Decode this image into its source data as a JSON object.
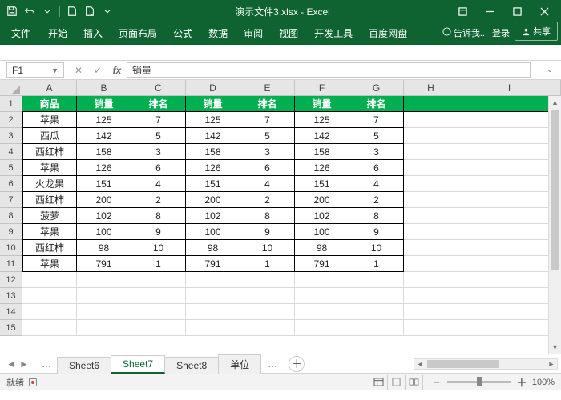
{
  "titlebar": {
    "title": "演示文件3.xlsx - Excel"
  },
  "ribbon": {
    "tabs": [
      "文件",
      "开始",
      "插入",
      "页面布局",
      "公式",
      "数据",
      "审阅",
      "视图",
      "开发工具",
      "百度网盘"
    ],
    "tell": "告诉我...",
    "login": "登录",
    "share": "共享"
  },
  "namebox": {
    "ref": "F1",
    "formula": "销量"
  },
  "columns": [
    "A",
    "B",
    "C",
    "D",
    "E",
    "F",
    "G",
    "H",
    "I"
  ],
  "header_row": [
    "商品",
    "销量",
    "排名",
    "销量",
    "排名",
    "销量",
    "排名"
  ],
  "data_rows": [
    {
      "n": 2,
      "c": [
        "苹果",
        "125",
        "7",
        "125",
        "7",
        "125",
        "7"
      ]
    },
    {
      "n": 3,
      "c": [
        "西瓜",
        "142",
        "5",
        "142",
        "5",
        "142",
        "5"
      ]
    },
    {
      "n": 4,
      "c": [
        "西红柿",
        "158",
        "3",
        "158",
        "3",
        "158",
        "3"
      ]
    },
    {
      "n": 5,
      "c": [
        "苹果",
        "126",
        "6",
        "126",
        "6",
        "126",
        "6"
      ]
    },
    {
      "n": 6,
      "c": [
        "火龙果",
        "151",
        "4",
        "151",
        "4",
        "151",
        "4"
      ]
    },
    {
      "n": 7,
      "c": [
        "西红柿",
        "200",
        "2",
        "200",
        "2",
        "200",
        "2"
      ]
    },
    {
      "n": 8,
      "c": [
        "菠萝",
        "102",
        "8",
        "102",
        "8",
        "102",
        "8"
      ]
    },
    {
      "n": 9,
      "c": [
        "苹果",
        "100",
        "9",
        "100",
        "9",
        "100",
        "9"
      ]
    },
    {
      "n": 10,
      "c": [
        "西红柿",
        "98",
        "10",
        "98",
        "10",
        "98",
        "10"
      ]
    },
    {
      "n": 11,
      "c": [
        "苹果",
        "791",
        "1",
        "791",
        "1",
        "791",
        "1"
      ]
    }
  ],
  "empty_rows": [
    12,
    13,
    14,
    15
  ],
  "sheets": {
    "prev": "Sheet6",
    "active": "Sheet7",
    "next": "Sheet8",
    "other": "单位"
  },
  "status": {
    "ready": "就绪",
    "zoom": "100%"
  }
}
